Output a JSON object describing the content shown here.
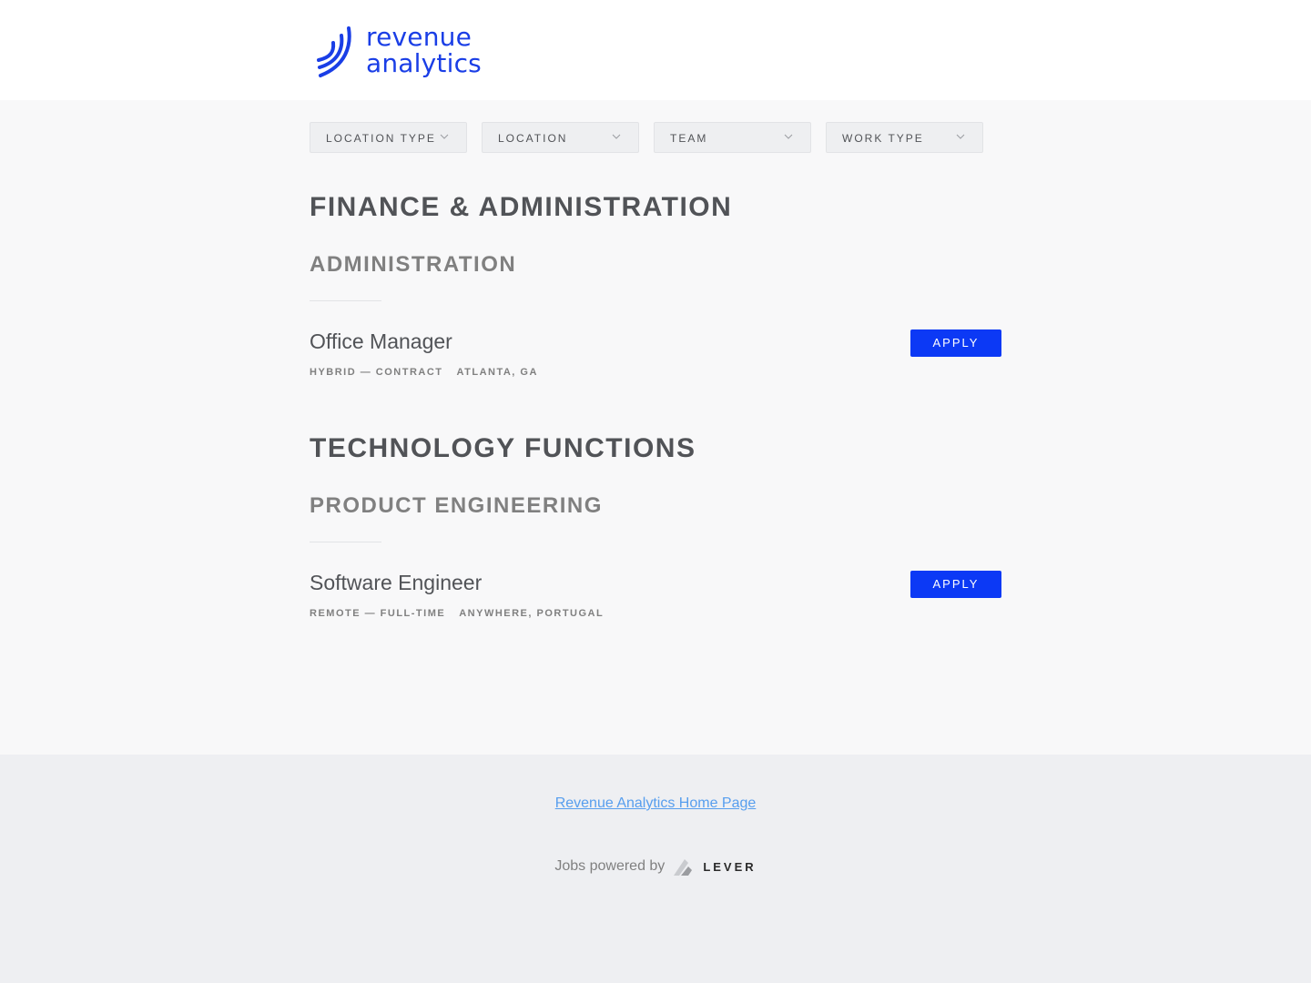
{
  "header": {
    "logo_line1": "revenue",
    "logo_line2": "analytics",
    "brand_color": "#1a3ee6"
  },
  "filters": [
    {
      "label": "LOCATION TYPE"
    },
    {
      "label": "LOCATION"
    },
    {
      "label": "TEAM"
    },
    {
      "label": "WORK TYPE"
    }
  ],
  "departments": [
    {
      "title": "FINANCE & ADMINISTRATION",
      "team": "ADMINISTRATION",
      "posting": {
        "title": "Office Manager",
        "workplace_commitment": "HYBRID — CONTRACT",
        "location": "ATLANTA, GA",
        "apply_label": "APPLY"
      }
    },
    {
      "title": "TECHNOLOGY FUNCTIONS",
      "team": "PRODUCT ENGINEERING",
      "posting": {
        "title": "Software Engineer",
        "workplace_commitment": "REMOTE — FULL-TIME",
        "location": "ANYWHERE, PORTUGAL",
        "apply_label": "APPLY"
      }
    }
  ],
  "footer": {
    "home_link": "Revenue Analytics Home Page",
    "powered_by": "Jobs powered by",
    "lever": "LEVER"
  },
  "colors": {
    "apply_button": "#0c39f5",
    "link": "#579eee"
  }
}
